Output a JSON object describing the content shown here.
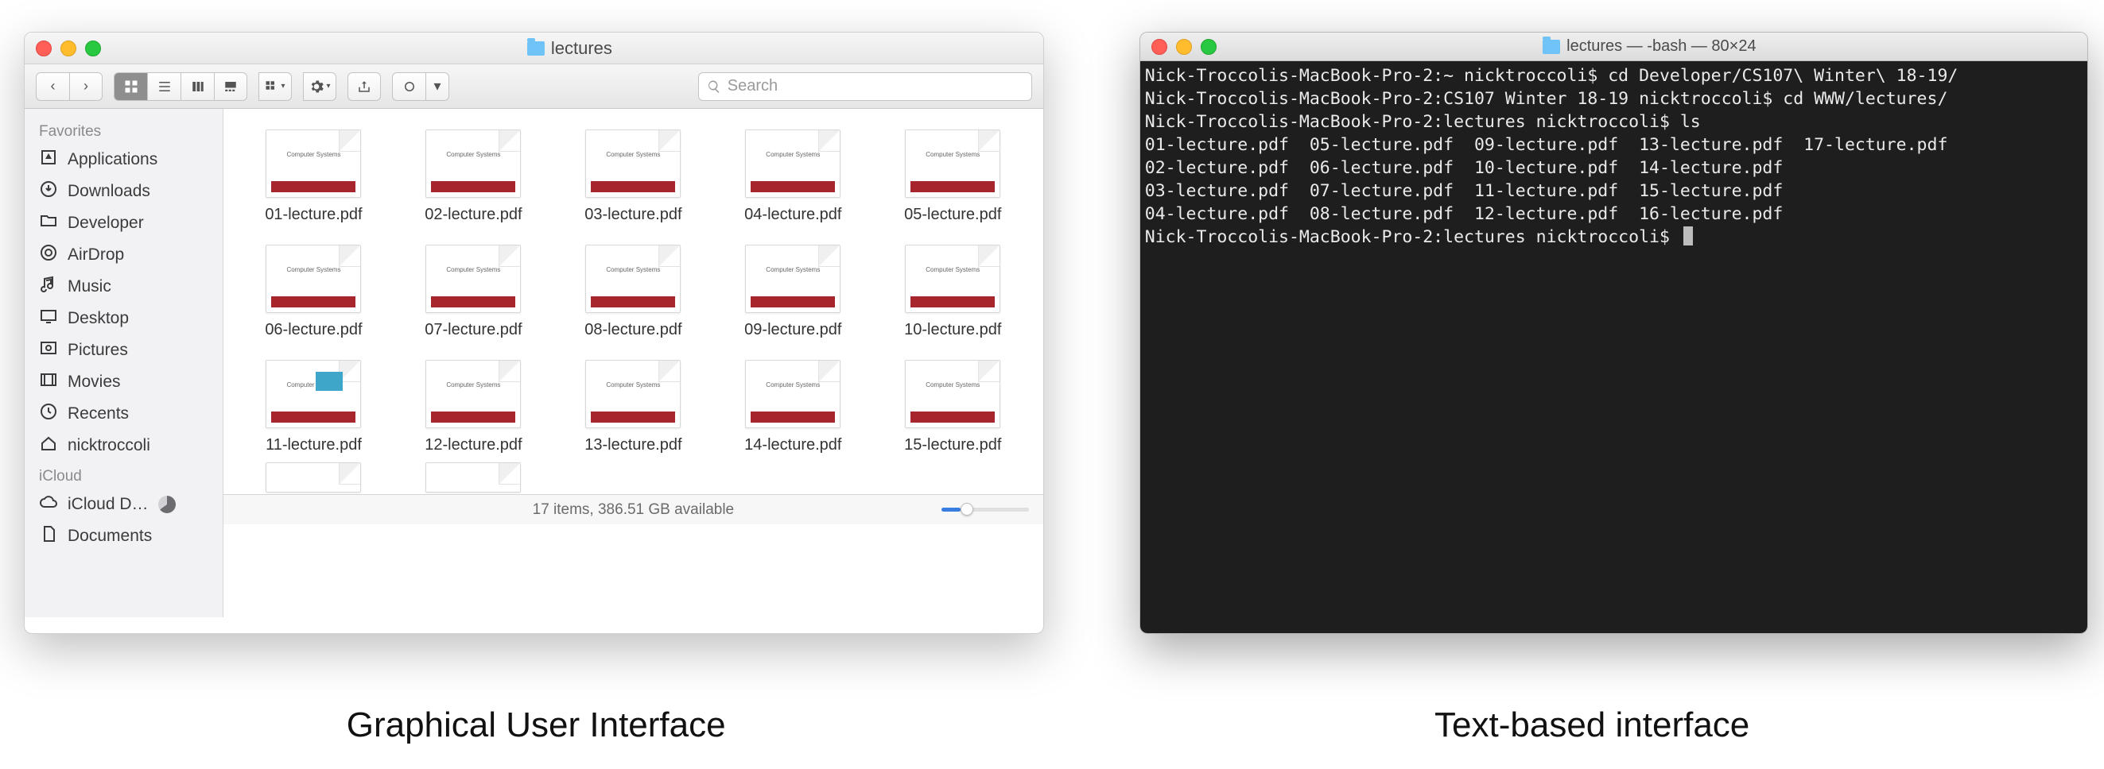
{
  "finder": {
    "title": "lectures",
    "search_placeholder": "Search",
    "sidebar": {
      "favorites_label": "Favorites",
      "icloud_label": "iCloud",
      "items": [
        {
          "label": "Applications",
          "icon": "apps"
        },
        {
          "label": "Downloads",
          "icon": "downloads"
        },
        {
          "label": "Developer",
          "icon": "folder"
        },
        {
          "label": "AirDrop",
          "icon": "airdrop"
        },
        {
          "label": "Music",
          "icon": "music"
        },
        {
          "label": "Desktop",
          "icon": "desktop"
        },
        {
          "label": "Pictures",
          "icon": "pictures"
        },
        {
          "label": "Movies",
          "icon": "movies"
        },
        {
          "label": "Recents",
          "icon": "recents"
        },
        {
          "label": "nicktroccoli",
          "icon": "home"
        }
      ],
      "icloud_items": [
        {
          "label": "iCloud D…",
          "icon": "cloud",
          "pie": true
        },
        {
          "label": "Documents",
          "icon": "documents"
        }
      ]
    },
    "files": [
      "01-lecture.pdf",
      "02-lecture.pdf",
      "03-lecture.pdf",
      "04-lecture.pdf",
      "05-lecture.pdf",
      "06-lecture.pdf",
      "07-lecture.pdf",
      "08-lecture.pdf",
      "09-lecture.pdf",
      "10-lecture.pdf",
      "11-lecture.pdf",
      "12-lecture.pdf",
      "13-lecture.pdf",
      "14-lecture.pdf",
      "15-lecture.pdf"
    ],
    "thumb_label": "Computer Systems",
    "status": "17 items, 386.51 GB available"
  },
  "terminal": {
    "title": "lectures — -bash — 80×24",
    "lines": [
      "Nick-Troccolis-MacBook-Pro-2:~ nicktroccoli$ cd Developer/CS107\\ Winter\\ 18-19/",
      "Nick-Troccolis-MacBook-Pro-2:CS107 Winter 18-19 nicktroccoli$ cd WWW/lectures/",
      "Nick-Troccolis-MacBook-Pro-2:lectures nicktroccoli$ ls",
      "01-lecture.pdf  05-lecture.pdf  09-lecture.pdf  13-lecture.pdf  17-lecture.pdf",
      "02-lecture.pdf  06-lecture.pdf  10-lecture.pdf  14-lecture.pdf",
      "03-lecture.pdf  07-lecture.pdf  11-lecture.pdf  15-lecture.pdf",
      "04-lecture.pdf  08-lecture.pdf  12-lecture.pdf  16-lecture.pdf",
      "Nick-Troccolis-MacBook-Pro-2:lectures nicktroccoli$ "
    ]
  },
  "captions": {
    "left": "Graphical User Interface",
    "right": "Text-based interface"
  }
}
